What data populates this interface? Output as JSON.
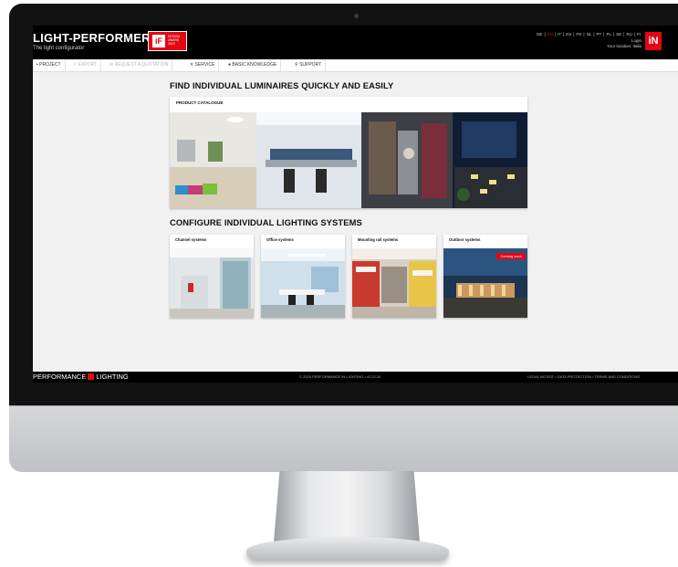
{
  "header": {
    "logo_text": "LIGHT-PERFORMER",
    "logo_mark": "®",
    "tagline": "The light configurator",
    "award": {
      "mark": "iF",
      "text": "DESIGN\nAWARD\n2019"
    },
    "languages": [
      "DE",
      "EN",
      "IT",
      "ES",
      "FR",
      "NL",
      "PT",
      "PL",
      "SE",
      "RU",
      "FI"
    ],
    "active_language": "EN",
    "login_label": "Login",
    "location_label": "Your location: Italia",
    "brand_mark": "iN"
  },
  "nav": {
    "items": [
      {
        "label": "PROJECT",
        "icon": "folder-icon",
        "enabled": true
      },
      {
        "label": "EXPORT",
        "icon": "export-icon",
        "enabled": false
      },
      {
        "label": "REQUEST A QUOTATION",
        "icon": "quote-icon",
        "enabled": false
      },
      {
        "label": "SERVICE",
        "icon": "tools-icon",
        "enabled": true
      },
      {
        "label": "BASIC KNOWLEDGE",
        "icon": "info-icon",
        "enabled": true
      },
      {
        "label": "SUPPORT",
        "icon": "pin-icon",
        "enabled": true
      }
    ]
  },
  "main": {
    "heading_find": "FIND INDIVIDUAL LUMINAIRES QUICKLY AND EASILY",
    "catalogue_label": "PRODUCT CATALOGUE",
    "heading_configure": "CONFIGURE INDIVIDUAL LIGHTING SYSTEMS",
    "systems": [
      {
        "label": "Channel systems"
      },
      {
        "label": "Office systems"
      },
      {
        "label": "Mounting rail systems"
      },
      {
        "label": "Outdoor systems",
        "badge": "Coming soon"
      }
    ]
  },
  "footer": {
    "logo_left": "PERFORMANCE",
    "logo_right": "LIGHTING",
    "copyright": "© 2020 PERFORMANCE IN LIGHTING • v2.22.24",
    "legal": "LEGAL NOTICE • DATA PROTECTION • TERMS AND CONDITIONS"
  },
  "colors": {
    "brand_red": "#e30613",
    "bar_black": "#000000",
    "page_bg": "#f1f1f1"
  }
}
